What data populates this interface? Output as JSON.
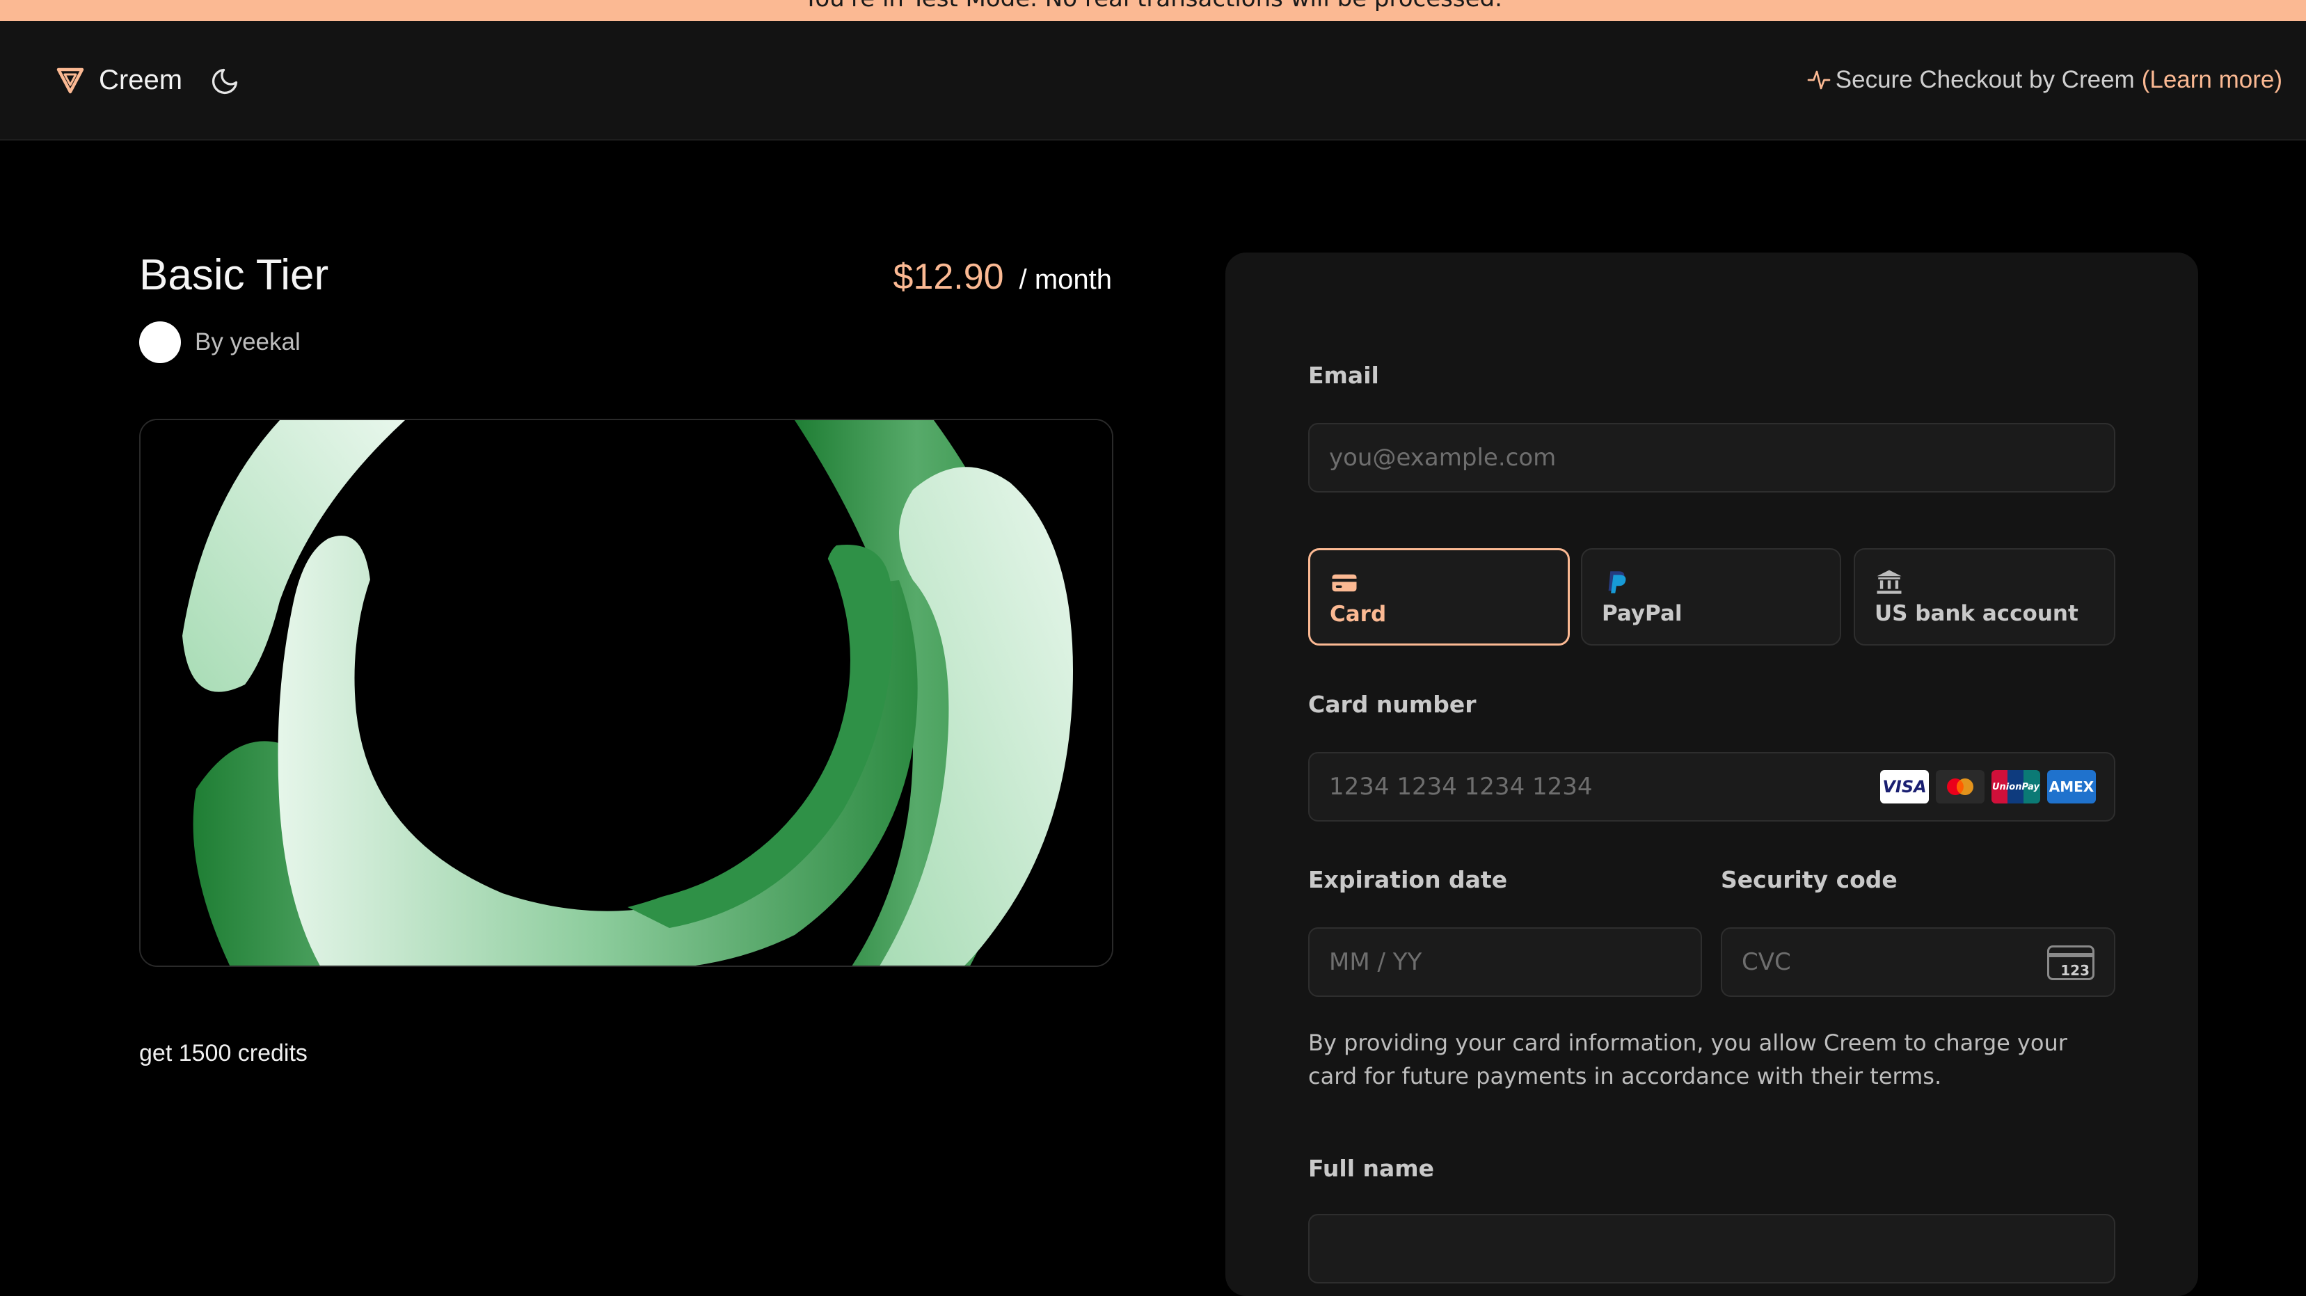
{
  "banner": {
    "text": "You're in Test Mode. No real transactions will be processed."
  },
  "header": {
    "brand": "Creem",
    "secure_text": "Secure Checkout by Creem",
    "learn_more": "(Learn more)"
  },
  "product": {
    "title": "Basic Tier",
    "price": "$12.90",
    "period": "/ month",
    "seller": "By yeekal",
    "description": "get 1500 credits"
  },
  "form": {
    "email_label": "Email",
    "email_placeholder": "you@example.com",
    "payment_methods": [
      {
        "label": "Card",
        "icon": "card-icon",
        "selected": true
      },
      {
        "label": "PayPal",
        "icon": "paypal-icon",
        "selected": false
      },
      {
        "label": "US bank account",
        "icon": "bank-icon",
        "selected": false
      }
    ],
    "card_number_label": "Card number",
    "card_number_placeholder": "1234 1234 1234 1234",
    "card_brands": [
      "VISA",
      "Mastercard",
      "UnionPay",
      "AMEX"
    ],
    "expiry_label": "Expiration date",
    "expiry_placeholder": "MM / YY",
    "cvc_label": "Security code",
    "cvc_placeholder": "CVC",
    "cvc_icon_text": "123",
    "consent": "By providing your card information, you allow Creem to charge your card for future payments in accordance with their terms.",
    "full_name_label": "Full name"
  },
  "colors": {
    "accent": "#fbb993",
    "background": "#000000",
    "panel": "#141414"
  }
}
